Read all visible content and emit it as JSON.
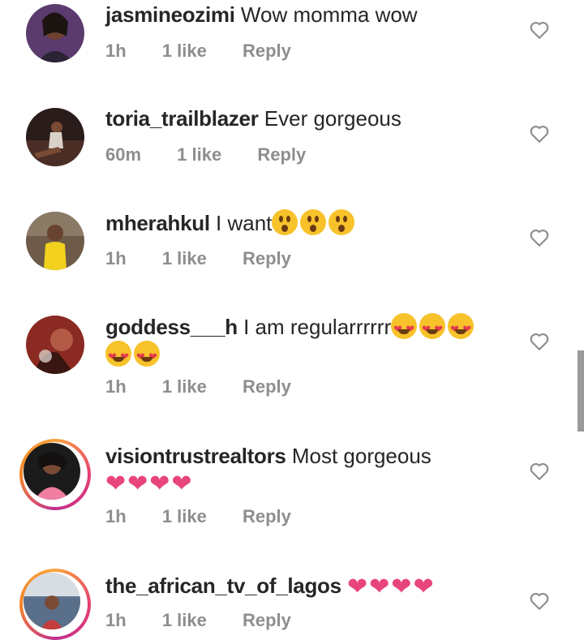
{
  "comments": [
    {
      "username": "jasmineozimi",
      "text": "Wow momma wow",
      "time": "1h",
      "likes": "1 like",
      "reply": "Reply"
    },
    {
      "username": "toria_trailblazer",
      "text": "Ever gorgeous",
      "time": "60m",
      "likes": "1 like",
      "reply": "Reply"
    },
    {
      "username": "mherahkul",
      "text": "I want",
      "time": "1h",
      "likes": "1 like",
      "reply": "Reply"
    },
    {
      "username": "goddess___h",
      "text": "I am regularrrrrr",
      "time": "1h",
      "likes": "1 like",
      "reply": "Reply"
    },
    {
      "username": "visiontrustrealtors",
      "text": "Most gorgeous",
      "time": "1h",
      "likes": "1 like",
      "reply": "Reply"
    },
    {
      "username": "the_african_tv_of_lagos",
      "text": "",
      "time": "1h",
      "likes": "1 like",
      "reply": "Reply"
    }
  ],
  "icons": {
    "like": "heart-outline-icon"
  },
  "colors": {
    "text": "#262626",
    "meta": "#8e8e8e",
    "heart_emoji": "#e8457a"
  }
}
